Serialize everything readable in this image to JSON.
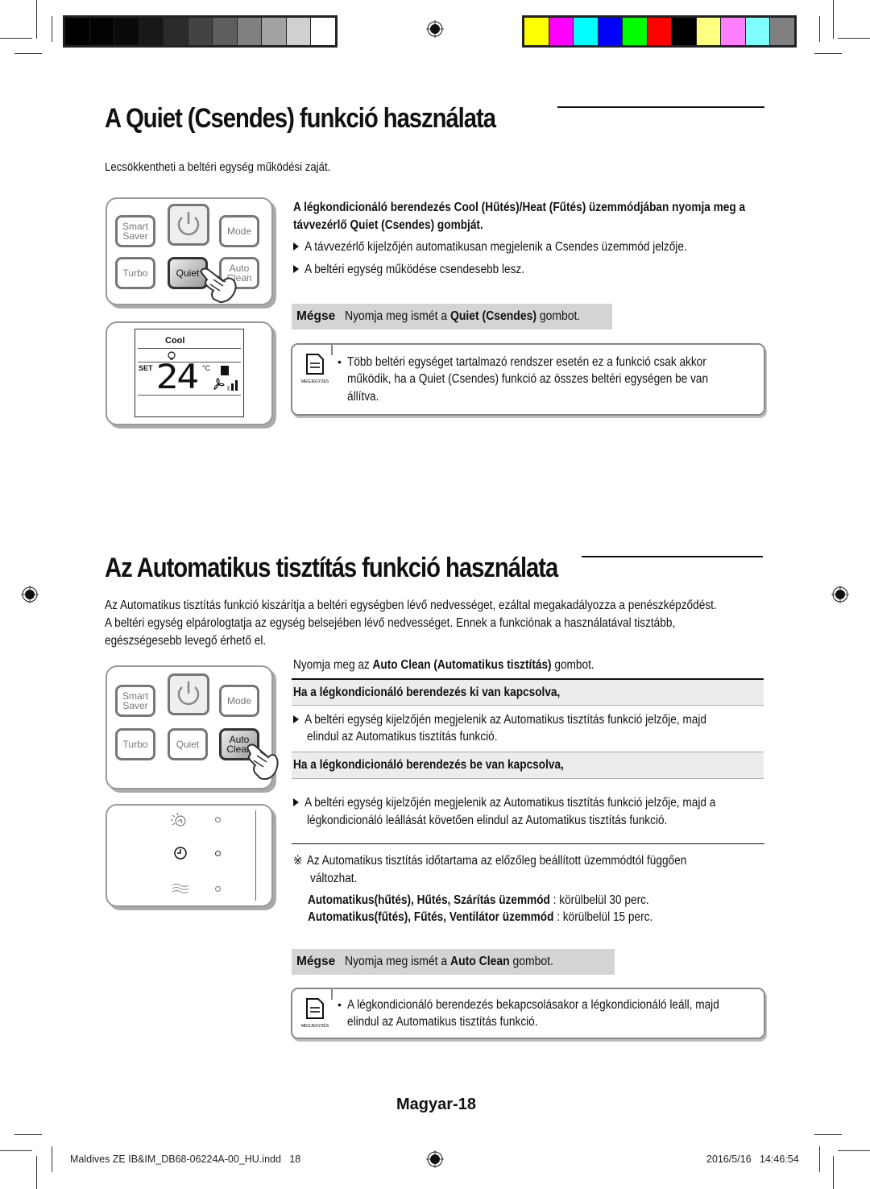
{
  "print_marks": {
    "grayscale_swatches": [
      "#000000",
      "#030303",
      "#0a0a0a",
      "#181818",
      "#2b2b2b",
      "#434343",
      "#5e5e5e",
      "#808080",
      "#a2a2a2",
      "#d0d0d0",
      "#ffffff"
    ],
    "color_swatches": [
      "#ffff00",
      "#ff00ff",
      "#00ffff",
      "#0000ff",
      "#00ff00",
      "#ff0000",
      "#000000",
      "#ffff80",
      "#ff80ff",
      "#80ffff",
      "#808080"
    ]
  },
  "quiet_section": {
    "title": "A Quiet (Csendes) funkció használata",
    "intro": "Lecsökkentheti a beltéri egység működési zaját.",
    "instruction_part1": "A légkondicionáló berendezés Cool (Hűtés)/Heat (Fűtés) üzemmódjában nyomja meg a",
    "instruction_part2_prefix": "távvezérlő ",
    "instruction_part2_bold": "Quiet (Csendes)",
    "instruction_part2_suffix": " gombját.",
    "bullets": [
      "A távvezérlő kijelzőjén automatikusan megjelenik a Csendes üzemmód jelzője.",
      "A beltéri egység működése csendesebb lesz."
    ],
    "cancel": {
      "label": "Mégse",
      "text_prefix": "Nyomja meg ismét a ",
      "text_bold": "Quiet (Csendes)",
      "text_suffix": " gombot."
    },
    "note": {
      "icon_label": "MEGJEGYZÉS",
      "lines": [
        "Több beltéri egységet tartalmazó rendszer esetén ez a funkció csak akkor",
        "működik, ha a Quiet (Csendes) funkció az összes beltéri egységen be van",
        "állítva."
      ]
    },
    "remote": {
      "buttons": [
        "Smart Saver",
        "Mode",
        "Turbo",
        "Quiet",
        "Auto Clean"
      ],
      "smart_line1": "Smart",
      "smart_line2": "Saver",
      "mode": "Mode",
      "turbo": "Turbo",
      "quiet": "Quiet",
      "auto_line1": "Auto",
      "auto_line2": "Clean",
      "pressed": "Quiet"
    },
    "display": {
      "mode": "Cool",
      "set_label": "SET",
      "temperature": "24",
      "unit": "°C"
    }
  },
  "autoclean_section": {
    "title": "Az Automatikus tisztítás funkció használata",
    "intro_lines": [
      "Az Automatikus tisztítás funkció kiszárítja a beltéri egységben lévő nedvességet, ezáltal megakadályozza a penészképződést.",
      "A beltéri egység elpárologtatja az egység belsejében lévő nedvességet. Ennek a funkciónak a használatával tisztább,",
      "egészségesebb levegő érhető el."
    ],
    "instruction_prefix": "Nyomja meg az ",
    "instruction_bold": "Auto Clean (Automatikus tisztítás)",
    "instruction_suffix": " gombot.",
    "case_off": {
      "heading": "Ha a légkondicionáló berendezés ki van kapcsolva,",
      "bullet_line1": "A beltéri egység kijelzőjén megjelenik az Automatikus tisztítás funkció jelzője, majd",
      "bullet_line2": "elindul az Automatikus tisztítás funkció."
    },
    "case_on": {
      "heading": "Ha a légkondicionáló berendezés be van kapcsolva,",
      "bullet_line1": "A beltéri egység kijelzőjén megjelenik az Automatikus tisztítás funkció jelzője, majd a",
      "bullet_line2": "légkondicionáló leállását követően elindul az Automatikus tisztítás funkció."
    },
    "remark": {
      "symbol": "※",
      "line1": "Az Automatikus tisztítás időtartama az előzőleg beállított üzemmódtól függően",
      "line2": "változhat.",
      "durations": [
        {
          "modes": "Automatikus(hűtés), Hűtés, Szárítás üzemmód",
          "duration": " : körülbelül 30 perc."
        },
        {
          "modes": "Automatikus(fűtés), Fűtés, Ventilátor üzemmód",
          "duration": " : körülbelül 15 perc."
        }
      ]
    },
    "cancel": {
      "label": "Mégse",
      "text_prefix": "Nyomja meg ismét a ",
      "text_bold": "Auto Clean",
      "text_suffix": " gombot."
    },
    "note": {
      "icon_label": "MEGJEGYZÉS",
      "lines": [
        "A légkondicionáló berendezés bekapcsolásakor a légkondicionáló leáll, majd",
        "elindul az Automatikus tisztítás funkció."
      ]
    },
    "remote": {
      "smart_line1": "Smart",
      "smart_line2": "Saver",
      "mode": "Mode",
      "turbo": "Turbo",
      "quiet": "Quiet",
      "auto_line1": "Auto",
      "auto_line2": "Clean",
      "pressed": "Auto Clean"
    },
    "indicator_panel": {
      "icons": [
        "auto-clean-indicator",
        "timer-indicator",
        "airflow-indicator"
      ]
    }
  },
  "page_number": "Magyar-18",
  "footer": {
    "file": "Maldives ZE IB&IM_DB68-06224A-00_HU.indd   18",
    "timestamp": "2016/5/16   14:46:54"
  }
}
